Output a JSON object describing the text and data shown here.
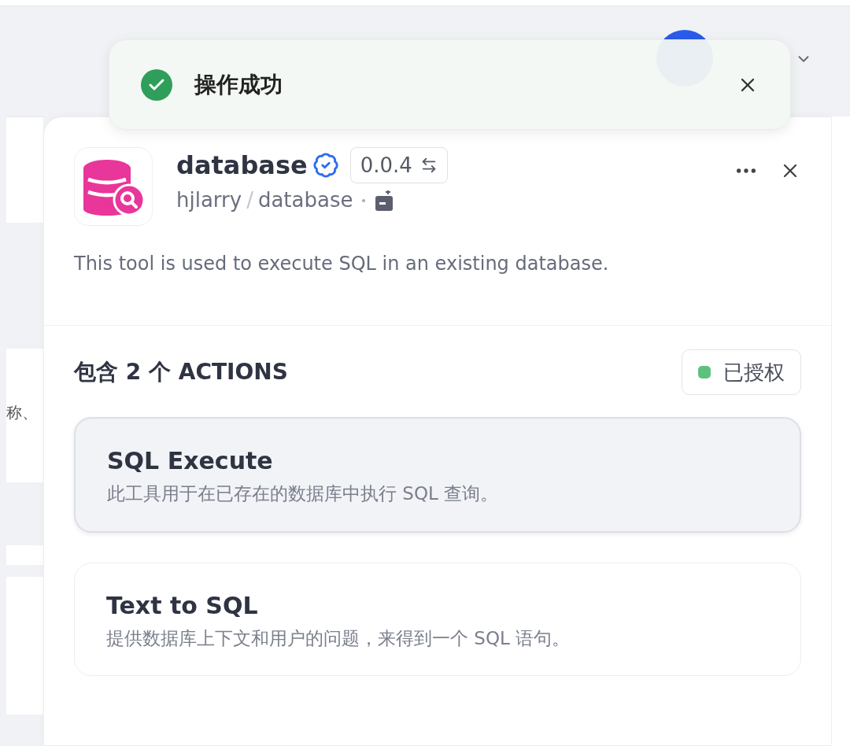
{
  "background_page": {
    "text_fragment": "称、"
  },
  "toast": {
    "kind": "success",
    "message": "操作成功"
  },
  "plugin": {
    "name": "database",
    "verified": true,
    "version": "0.0.4",
    "author": "hjlarry",
    "separator": "/",
    "repo": "database",
    "description": "This tool is used to execute SQL in an existing database."
  },
  "actions_section": {
    "title": "包含 2 个 ACTIONS",
    "status": {
      "label": "已授权",
      "color": "#5cc17c"
    }
  },
  "actions": [
    {
      "name": "SQL Execute",
      "description": "此工具用于在已存在的数据库中执行 SQL 查询。",
      "selected": true
    },
    {
      "name": "Text to SQL",
      "description": "提供数据库上下文和用户的问题，来得到一个 SQL 语句。",
      "selected": false
    }
  ]
}
